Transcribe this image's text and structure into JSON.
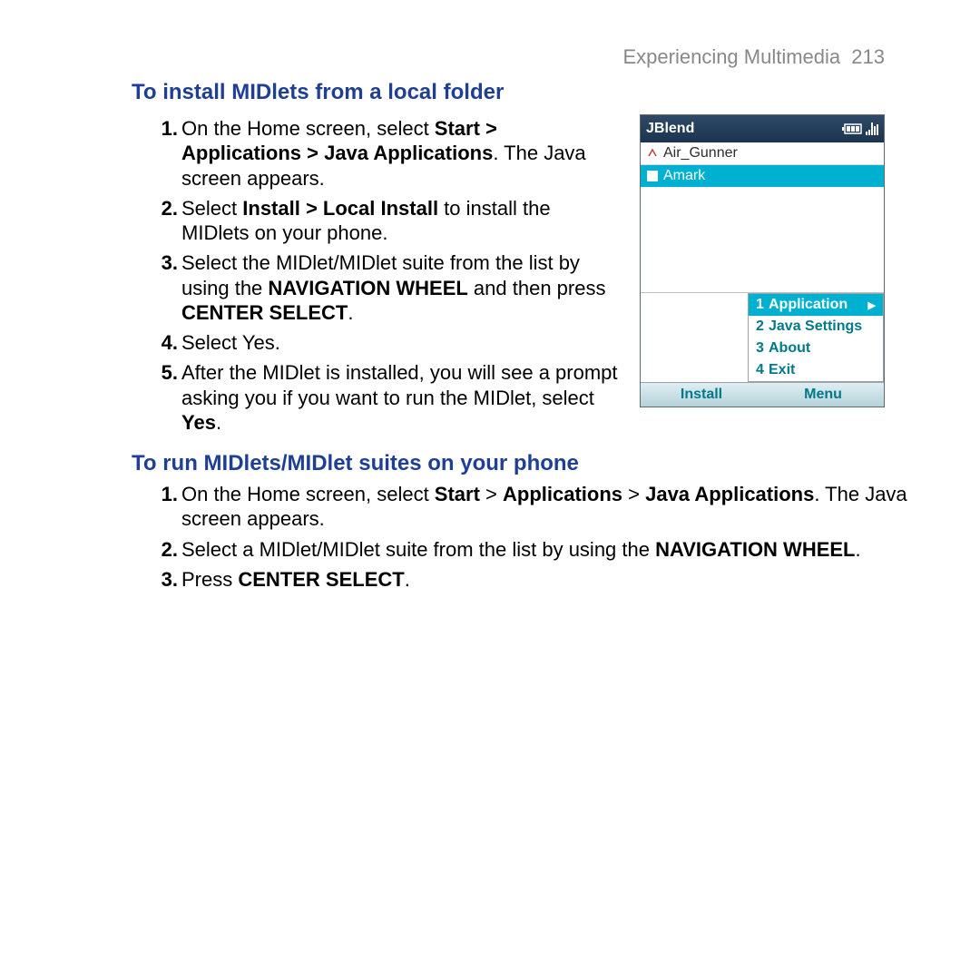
{
  "header": {
    "section": "Experiencing Multimedia",
    "page": "213"
  },
  "section1": {
    "title": "To install MIDlets from a local folder",
    "steps": [
      {
        "num": "1.",
        "parts": [
          {
            "t": "On the Home screen, select "
          },
          {
            "t": "Start > Applications > Java Applications",
            "b": true
          },
          {
            "t": ". The Java screen appears."
          }
        ]
      },
      {
        "num": "2.",
        "parts": [
          {
            "t": "Select "
          },
          {
            "t": "Install > Local Install",
            "b": true
          },
          {
            "t": " to install the MIDlets on your phone."
          }
        ]
      },
      {
        "num": "3.",
        "parts": [
          {
            "t": "Select the MIDlet/MIDlet suite from the list by using the "
          },
          {
            "t": "NAVIGATION WHEEL",
            "b": true
          },
          {
            "t": " and then press "
          },
          {
            "t": "CENTER SELECT",
            "b": true
          },
          {
            "t": "."
          }
        ]
      },
      {
        "num": "4.",
        "parts": [
          {
            "t": "Select Yes."
          }
        ]
      },
      {
        "num": "5.",
        "parts": [
          {
            "t": "After the MIDlet is installed, you will see a prompt asking you if you want to run the MIDlet, select "
          },
          {
            "t": "Yes",
            "b": true
          },
          {
            "t": "."
          }
        ]
      }
    ]
  },
  "section2": {
    "title": "To run MIDlets/MIDlet suites on your phone",
    "steps": [
      {
        "num": "1.",
        "parts": [
          {
            "t": "On the Home screen, select "
          },
          {
            "t": "Start",
            "b": true
          },
          {
            "t": " > "
          },
          {
            "t": "Applications",
            "b": true
          },
          {
            "t": " > "
          },
          {
            "t": "Java Applications",
            "b": true
          },
          {
            "t": ". The Java screen appears."
          }
        ]
      },
      {
        "num": "2.",
        "parts": [
          {
            "t": "Select a MIDlet/MIDlet suite from the list by using the "
          },
          {
            "t": "NAVIGATION WHEEL",
            "b": true
          },
          {
            "t": "."
          }
        ]
      },
      {
        "num": "3.",
        "parts": [
          {
            "t": "Press "
          },
          {
            "t": "CENTER SELECT",
            "b": true
          },
          {
            "t": "."
          }
        ]
      }
    ]
  },
  "phone": {
    "title": "JBlend",
    "apps": [
      {
        "name": "Air_Gunner",
        "selected": false
      },
      {
        "name": "Amark",
        "selected": true
      }
    ],
    "menu": [
      {
        "num": "1",
        "label": "Application",
        "selected": true,
        "arrow": true
      },
      {
        "num": "2",
        "label": "Java Settings",
        "selected": false
      },
      {
        "num": "3",
        "label": "About",
        "selected": false
      },
      {
        "num": "4",
        "label": "Exit",
        "selected": false
      }
    ],
    "softkeys": {
      "left": "Install",
      "right": "Menu"
    }
  }
}
